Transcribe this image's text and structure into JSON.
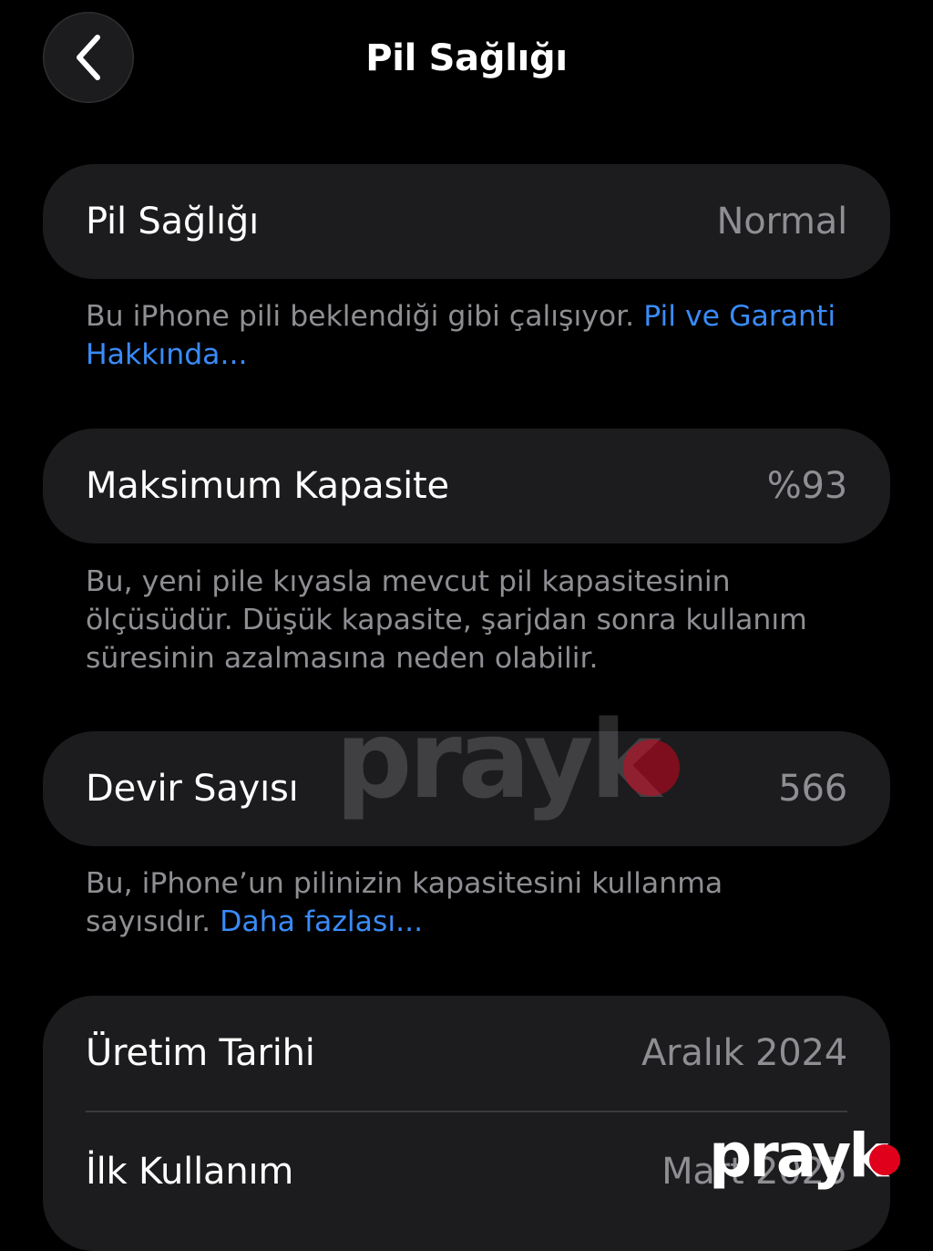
{
  "nav": {
    "back_icon": "chevron-left-icon",
    "title": "Pil Sağlığı"
  },
  "battery_health": {
    "label": "Pil Sağlığı",
    "value": "Normal",
    "note": "Bu iPhone pili beklendiği gibi çalışıyor.",
    "link": "Pil ve Garanti Hakkında..."
  },
  "max_capacity": {
    "label": "Maksimum Kapasite",
    "value": "%93",
    "note": "Bu, yeni pile kıyasla mevcut pil kapasitesinin ölçüsüdür. Düşük kapasite, şarjdan sonra kullanım süresinin azalmasına neden olabilir."
  },
  "cycle_count": {
    "label": "Devir Sayısı",
    "value": "566",
    "note": "Bu, iPhone’un pilinizin kapasitesini kullanma sayısıdır.",
    "link": "Daha fazlası..."
  },
  "dates": {
    "manufacture_label": "Üretim Tarihi",
    "manufacture_value": "Aralık 2024",
    "first_use_label": "İlk Kullanım",
    "first_use_value": "Mart 2025"
  },
  "watermark": {
    "text": "prayk",
    "dot_color": "#e0001b"
  },
  "colors": {
    "background": "#000000",
    "card": "#1c1c1e",
    "secondary_text": "#8e8e93",
    "link": "#3a8bf8"
  }
}
